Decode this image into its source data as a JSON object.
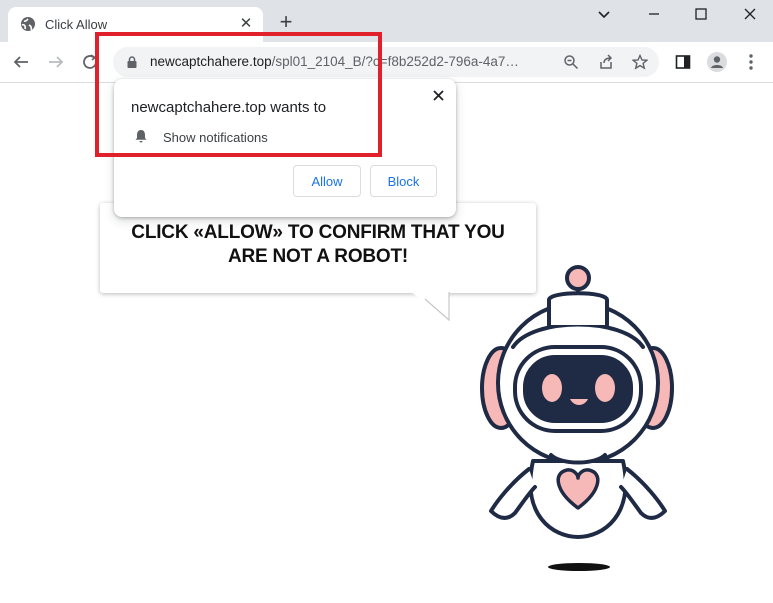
{
  "browser": {
    "tab": {
      "title": "Click Allow",
      "favicon": "globe-icon",
      "close_icon": "close-icon"
    },
    "new_tab_icon": "plus-icon",
    "window_controls": [
      "chevron-down-icon",
      "minimize-icon",
      "maximize-icon",
      "close-icon"
    ],
    "toolbar": {
      "back_icon": "arrow-left-icon",
      "forward_icon": "arrow-right-icon",
      "reload_icon": "reload-icon",
      "url_host": "newcaptchahere.top",
      "url_path": "/spl01_2104_B/?c=f8b252d2-796a-4a7…",
      "omnibox_icons": [
        "zoom-icon",
        "share-icon",
        "star-icon"
      ],
      "right_icons": [
        "side-panel-icon",
        "profile-icon",
        "kebab-menu-icon"
      ]
    }
  },
  "permission_prompt": {
    "title": "newcaptchahere.top wants to",
    "permission": "Show notifications",
    "allow_label": "Allow",
    "block_label": "Block"
  },
  "page": {
    "message": "CLICK «ALLOW» TO CONFIRM THAT YOU ARE NOT A ROBOT!"
  },
  "colors": {
    "highlight_border": "#e0202a",
    "robot_outline": "#1f2a44",
    "robot_accent": "#f7b8b8",
    "button_text": "#1a73e8"
  }
}
